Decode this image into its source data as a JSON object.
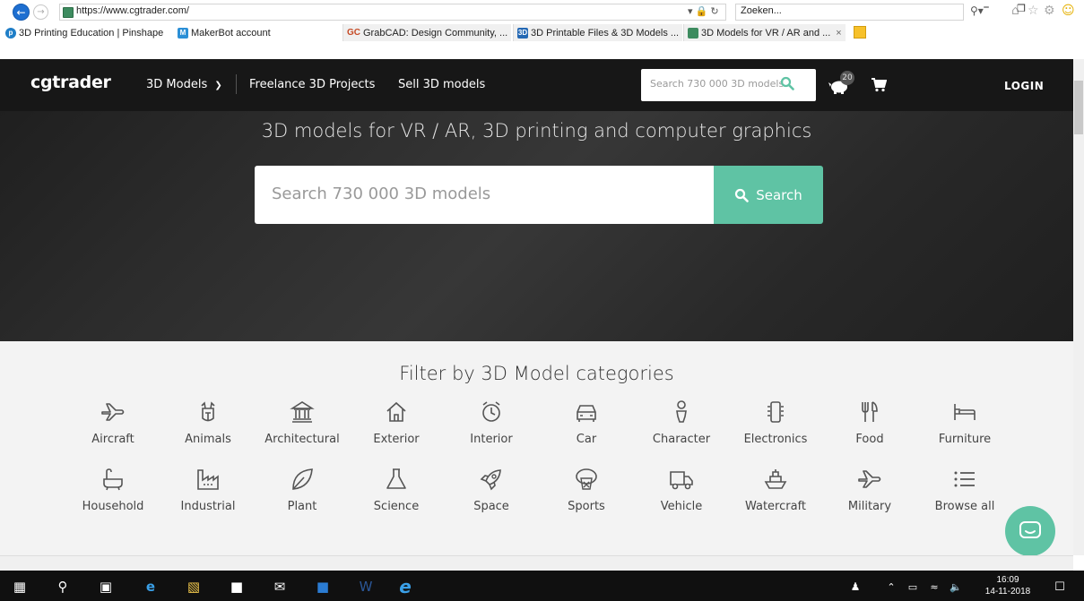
{
  "browser": {
    "url": "https://www.cgtrader.com/",
    "search_placeholder": "Zoeken...",
    "favorites": [
      {
        "label": "3D Printing Education | Pinshape"
      },
      {
        "label": "MakerBot account"
      }
    ],
    "tabs": [
      {
        "label": "GrabCAD: Design Community, ..."
      },
      {
        "label": "3D Printable Files & 3D Models ..."
      },
      {
        "label": "3D Models for VR / AR and ..."
      }
    ]
  },
  "header": {
    "logo": "cgtrader",
    "nav": [
      {
        "label": "3D Models"
      },
      {
        "label": "Freelance 3D Projects"
      },
      {
        "label": "Sell 3D models"
      }
    ],
    "search_placeholder": "Search 730 000 3D models",
    "piggy_count": "20",
    "login": "LOGIN"
  },
  "hero": {
    "title": "3D models for VR / AR, 3D printing and computer graphics",
    "search_placeholder": "Search 730 000 3D models",
    "search_button": "Search"
  },
  "categories": {
    "title": "Filter by 3D Model categories",
    "row1": [
      {
        "label": "Aircraft",
        "icon": "aircraft-icon"
      },
      {
        "label": "Animals",
        "icon": "animals-icon"
      },
      {
        "label": "Architectural",
        "icon": "architectural-icon"
      },
      {
        "label": "Exterior",
        "icon": "exterior-icon"
      },
      {
        "label": "Interior",
        "icon": "interior-icon"
      },
      {
        "label": "Car",
        "icon": "car-icon"
      },
      {
        "label": "Character",
        "icon": "character-icon"
      },
      {
        "label": "Electronics",
        "icon": "electronics-icon"
      },
      {
        "label": "Food",
        "icon": "food-icon"
      },
      {
        "label": "Furniture",
        "icon": "furniture-icon"
      }
    ],
    "row2": [
      {
        "label": "Household",
        "icon": "household-icon"
      },
      {
        "label": "Industrial",
        "icon": "industrial-icon"
      },
      {
        "label": "Plant",
        "icon": "plant-icon"
      },
      {
        "label": "Science",
        "icon": "science-icon"
      },
      {
        "label": "Space",
        "icon": "space-icon"
      },
      {
        "label": "Sports",
        "icon": "sports-icon"
      },
      {
        "label": "Vehicle",
        "icon": "vehicle-icon"
      },
      {
        "label": "Watercraft",
        "icon": "watercraft-icon"
      },
      {
        "label": "Military",
        "icon": "military-icon"
      },
      {
        "label": "Browse all",
        "icon": "browse-all-icon"
      }
    ]
  },
  "taskbar": {
    "time": "16:09",
    "date": "14-11-2018"
  },
  "colors": {
    "accent": "#5fc3a4",
    "header_bg": "#171717",
    "categories_bg": "#f3f3f3"
  }
}
